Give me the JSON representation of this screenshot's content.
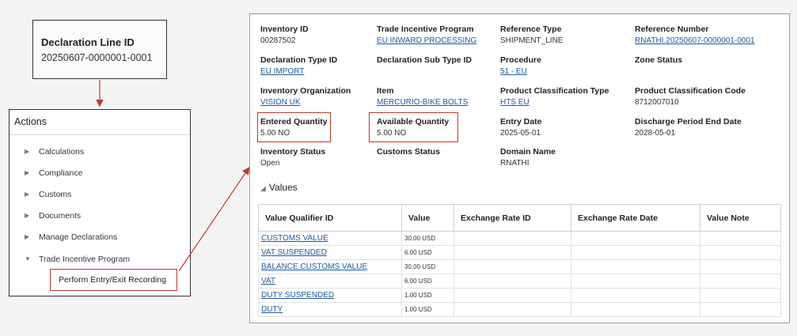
{
  "declaration": {
    "label": "Declaration Line ID",
    "value": "20250607-0000001-0001"
  },
  "actions": {
    "title": "Actions",
    "items": [
      {
        "label": "Calculations",
        "state": "collapsed"
      },
      {
        "label": "Compliance",
        "state": "collapsed"
      },
      {
        "label": "Customs",
        "state": "collapsed"
      },
      {
        "label": "Documents",
        "state": "collapsed"
      },
      {
        "label": "Manage Declarations",
        "state": "collapsed"
      },
      {
        "label": "Trade Incentive Program",
        "state": "expanded"
      }
    ],
    "sub_item": "Perform Entry/Exit Recording"
  },
  "details": {
    "inventory_id": {
      "label": "Inventory ID",
      "value": "00287502"
    },
    "trade_incentive_program": {
      "label": "Trade Incentive Program",
      "value": "EU INWARD PROCESSING"
    },
    "reference_type": {
      "label": "Reference Type",
      "value": "SHIPMENT_LINE"
    },
    "reference_number": {
      "label": "Reference Number",
      "value": "RNATHI.20250607-0000001-0001"
    },
    "declaration_type_id": {
      "label": "Declaration Type ID",
      "value": "EU IMPORT"
    },
    "declaration_sub_type_id": {
      "label": "Declaration Sub Type ID",
      "value": ""
    },
    "procedure": {
      "label": "Procedure",
      "value": "51 - EU"
    },
    "zone_status": {
      "label": "Zone Status",
      "value": ""
    },
    "inventory_organization": {
      "label": "Inventory Organization",
      "value": "VISION UK"
    },
    "item": {
      "label": "Item",
      "value": "MERCURIO-BIKE BOLTS"
    },
    "product_classification_type": {
      "label": "Product Classification Type",
      "value": "HTS EU"
    },
    "product_classification_code": {
      "label": "Product Classification Code",
      "value": "8712007010"
    },
    "entered_quantity": {
      "label": "Entered Quantity",
      "value": "5.00 NO"
    },
    "available_quantity": {
      "label": "Available Quantity",
      "value": "5.00 NO"
    },
    "entry_date": {
      "label": "Entry Date",
      "value": "2025-05-01"
    },
    "discharge_period_end_date": {
      "label": "Discharge Period End Date",
      "value": "2028-05-01"
    },
    "inventory_status": {
      "label": "Inventory Status",
      "value": "Open"
    },
    "customs_status": {
      "label": "Customs Status",
      "value": ""
    },
    "domain_name": {
      "label": "Domain Name",
      "value": "RNATHI"
    }
  },
  "values_section": {
    "title": "Values",
    "columns": [
      "Value Qualifier ID",
      "Value",
      "Exchange Rate ID",
      "Exchange Rate Date",
      "Value Note"
    ],
    "rows": [
      {
        "qualifier": "CUSTOMS VALUE",
        "value": "30.00 USD"
      },
      {
        "qualifier": "VAT SUSPENDED",
        "value": "6.00 USD"
      },
      {
        "qualifier": "BALANCE CUSTOMS VALUE",
        "value": "30.00 USD"
      },
      {
        "qualifier": "VAT",
        "value": "6.00 USD"
      },
      {
        "qualifier": "DUTY SUSPENDED",
        "value": "1.00 USD"
      },
      {
        "qualifier": "DUTY",
        "value": "1.00 USD"
      }
    ]
  },
  "colors": {
    "link": "#1c5aa5",
    "highlight": "#c0392b"
  },
  "icons": {
    "collapsed": "triangle-right-icon",
    "expanded": "triangle-down-icon",
    "arrow": "arrow-icon"
  }
}
